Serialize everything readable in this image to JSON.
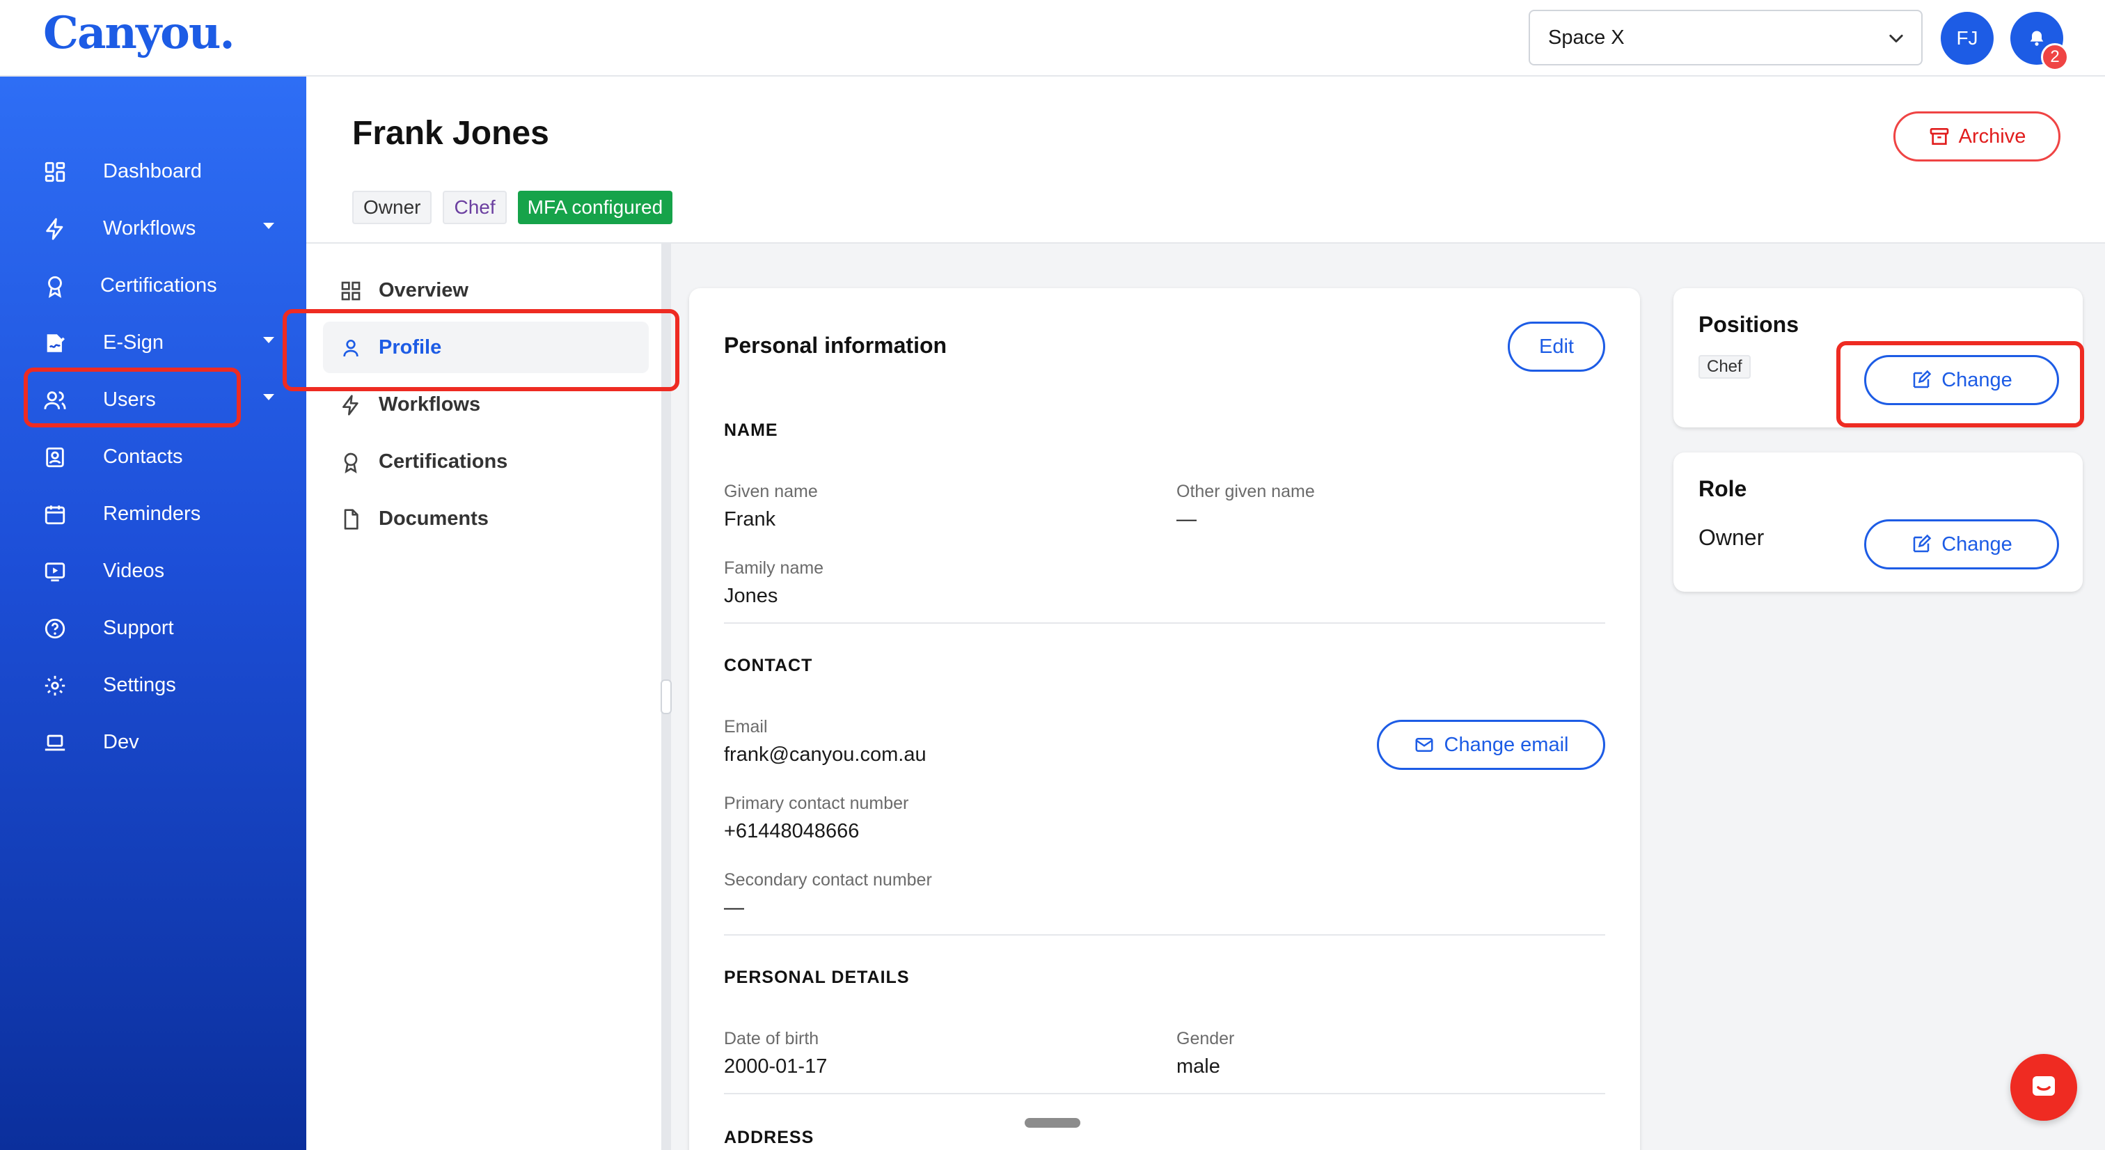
{
  "brand": {
    "logo": "Canyou."
  },
  "header": {
    "space_select": {
      "value": "Space X"
    },
    "avatar_initials": "FJ",
    "notification_count": "2"
  },
  "sidebar": {
    "items": [
      {
        "label": "Dashboard",
        "icon": "grid-icon"
      },
      {
        "label": "Workflows",
        "icon": "lightning-icon",
        "has_caret": true
      },
      {
        "label": "Certifications",
        "icon": "award-icon"
      },
      {
        "label": "E-Sign",
        "icon": "signature-icon",
        "has_caret": true
      },
      {
        "label": "Users",
        "icon": "users-icon",
        "has_caret": true,
        "active": true
      },
      {
        "label": "Contacts",
        "icon": "contact-card-icon"
      },
      {
        "label": "Reminders",
        "icon": "calendar-icon"
      },
      {
        "label": "Videos",
        "icon": "video-icon"
      },
      {
        "label": "Support",
        "icon": "question-icon"
      },
      {
        "label": "Settings",
        "icon": "gear-icon"
      },
      {
        "label": "Dev",
        "icon": "laptop-icon"
      }
    ]
  },
  "page": {
    "title": "Frank Jones",
    "badges": [
      "Owner",
      "Chef",
      "MFA configured"
    ],
    "archive_label": "Archive"
  },
  "subnav": {
    "items": [
      {
        "label": "Overview",
        "icon": "grid-icon"
      },
      {
        "label": "Profile",
        "icon": "user-icon",
        "active": true
      },
      {
        "label": "Workflows",
        "icon": "lightning-icon"
      },
      {
        "label": "Certifications",
        "icon": "award-icon"
      },
      {
        "label": "Documents",
        "icon": "document-icon"
      }
    ]
  },
  "personal_info": {
    "title": "Personal information",
    "edit_label": "Edit",
    "sections": {
      "name": "NAME",
      "contact": "CONTACT",
      "personal_details": "PERSONAL DETAILS",
      "address": "ADDRESS"
    },
    "fields": {
      "given_name": {
        "label": "Given name",
        "value": "Frank"
      },
      "other_given_name": {
        "label": "Other given name",
        "value": "—"
      },
      "family_name": {
        "label": "Family name",
        "value": "Jones"
      },
      "email": {
        "label": "Email",
        "value": "frank@canyou.com.au"
      },
      "primary_contact": {
        "label": "Primary contact number",
        "value": "+61448048666"
      },
      "secondary_contact": {
        "label": "Secondary contact number",
        "value": "—"
      },
      "dob": {
        "label": "Date of birth",
        "value": "2000-01-17"
      },
      "gender": {
        "label": "Gender",
        "value": "male"
      }
    },
    "change_email_label": "Change email"
  },
  "positions": {
    "title": "Positions",
    "chip": "Chef",
    "change_label": "Change"
  },
  "role": {
    "title": "Role",
    "value": "Owner",
    "change_label": "Change"
  },
  "colors": {
    "brand_blue": "#1d5ce5",
    "danger_red": "#ef4444",
    "success_green": "#16a34a",
    "annotation_red": "#ee2b22"
  }
}
